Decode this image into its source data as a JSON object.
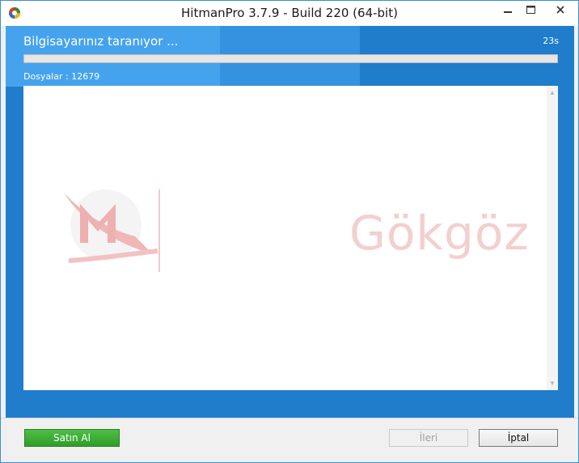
{
  "window": {
    "title": "HitmanPro 3.7.9 - Build 220 (64-bit)",
    "app_icon": "hitmanpro-logo-icon",
    "controls": [
      "minimize-icon",
      "maximize-icon",
      "close-icon"
    ]
  },
  "scan": {
    "heading": "Bilgisayarınız taranıyor ...",
    "timer": "23s",
    "progress": 0,
    "files_label": "Dosyalar : 12679"
  },
  "watermark": {
    "text": "Gökgöz"
  },
  "footer": {
    "buy_label": "Satın Al",
    "next_label": "İleri",
    "cancel_label": "İptal"
  },
  "colors": {
    "accent_blue": "#1f7dcc",
    "buy_green": "#3aa934",
    "watermark_red": "#e8a0a0"
  }
}
